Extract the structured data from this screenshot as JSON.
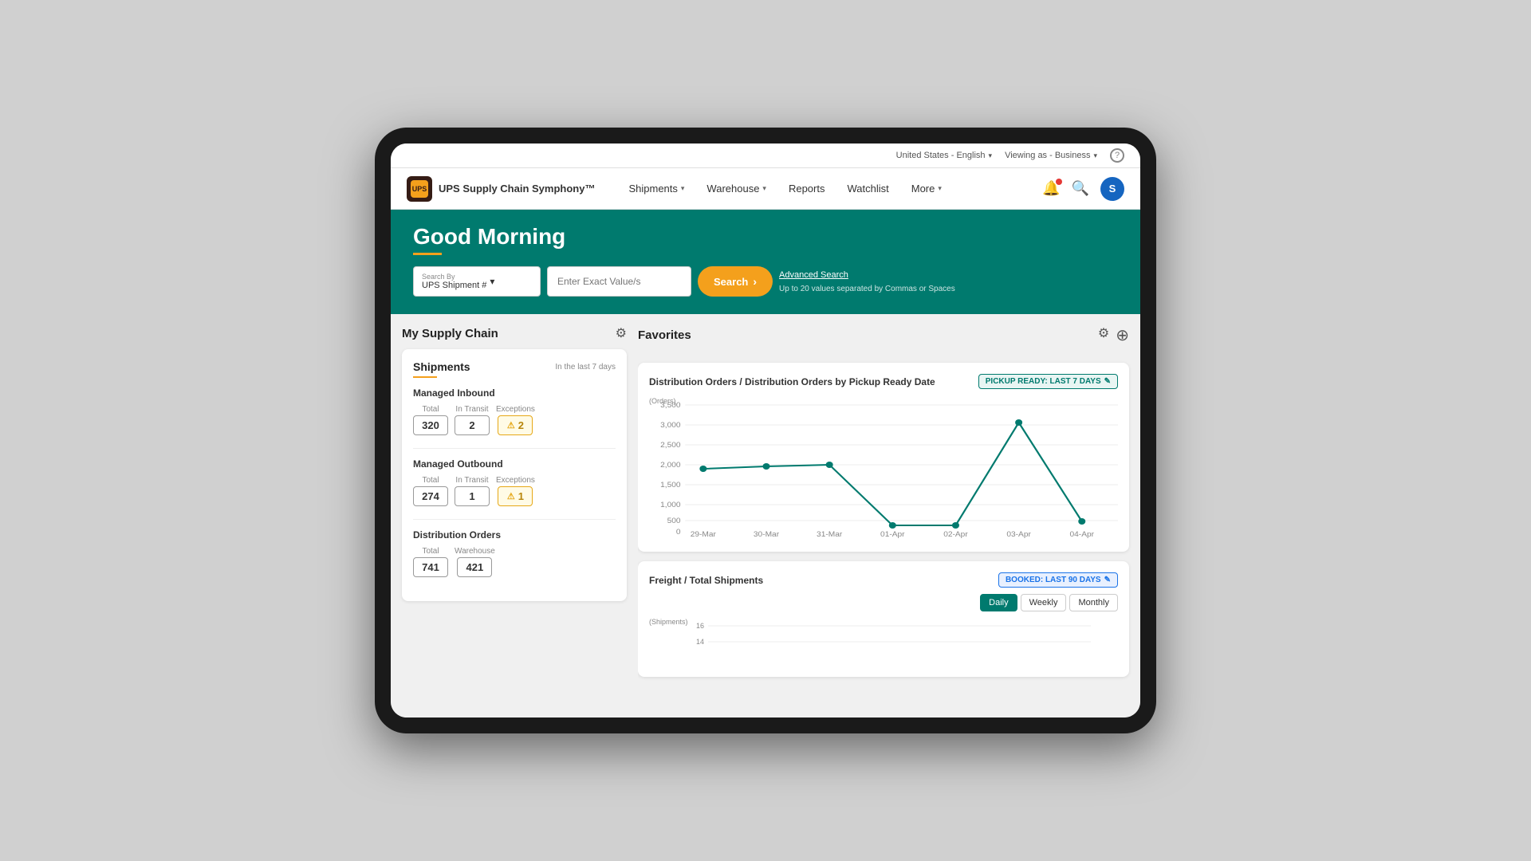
{
  "topbar": {
    "locale": "United States - English",
    "viewing_as": "Viewing as - Business",
    "help_label": "?"
  },
  "navbar": {
    "brand": "UPS Supply Chain Symphony™",
    "logo_text": "UPS",
    "nav_items": [
      {
        "label": "Shipments",
        "has_dropdown": true
      },
      {
        "label": "Warehouse",
        "has_dropdown": true
      },
      {
        "label": "Reports",
        "has_dropdown": false
      },
      {
        "label": "Watchlist",
        "has_dropdown": false
      },
      {
        "label": "More",
        "has_dropdown": true
      }
    ],
    "user_initial": "S"
  },
  "hero": {
    "greeting": "Good Morning",
    "search_by_label": "Search By",
    "search_by_value": "UPS Shipment #",
    "search_placeholder": "Enter Exact Value/s",
    "search_hint": "Up to 20 values separated by Commas or Spaces",
    "search_button": "Search",
    "advanced_search": "Advanced Search"
  },
  "supply_chain": {
    "section_title": "My Supply Chain",
    "card_title": "Shipments",
    "card_subtitle": "In the last 7 days",
    "sections": [
      {
        "title": "Managed Inbound",
        "total_label": "Total",
        "total_value": "320",
        "intransit_label": "In Transit",
        "intransit_value": "2",
        "exceptions_label": "Exceptions",
        "exceptions_value": "2"
      },
      {
        "title": "Managed Outbound",
        "total_label": "Total",
        "total_value": "274",
        "intransit_label": "In Transit",
        "intransit_value": "1",
        "exceptions_label": "Exceptions",
        "exceptions_value": "1"
      },
      {
        "title": "Distribution Orders",
        "total_label": "Total",
        "total_value": "741",
        "warehouse_label": "Warehouse",
        "warehouse_value": "421"
      }
    ]
  },
  "favorites": {
    "section_title": "Favorites",
    "chart1": {
      "title": "Distribution Orders / Distribution Orders by Pickup Ready Date",
      "badge": "PICKUP READY: LAST 7 DAYS",
      "y_label": "(Orders)",
      "x_labels": [
        "29-Mar",
        "30-Mar",
        "31-Mar",
        "01-Apr",
        "02-Apr",
        "03-Apr",
        "04-Apr"
      ],
      "y_ticks": [
        "3,500",
        "3,000",
        "2,500",
        "2,000",
        "1,500",
        "1,000",
        "500",
        "0"
      ],
      "data_points": [
        {
          "x": 0,
          "y": 1700
        },
        {
          "x": 1,
          "y": 1750
        },
        {
          "x": 2,
          "y": 1800
        },
        {
          "x": 3,
          "y": 100
        },
        {
          "x": 4,
          "y": 100
        },
        {
          "x": 5,
          "y": 3000
        },
        {
          "x": 6,
          "y": 200
        }
      ]
    },
    "chart2": {
      "title": "Freight / Total Shipments",
      "badge": "BOOKED: LAST 90 DAYS",
      "y_label": "(Shipments)",
      "y_ticks": [
        "16",
        "14"
      ],
      "time_tabs": [
        "Daily",
        "Weekly",
        "Monthly"
      ],
      "active_tab": "Daily"
    }
  }
}
